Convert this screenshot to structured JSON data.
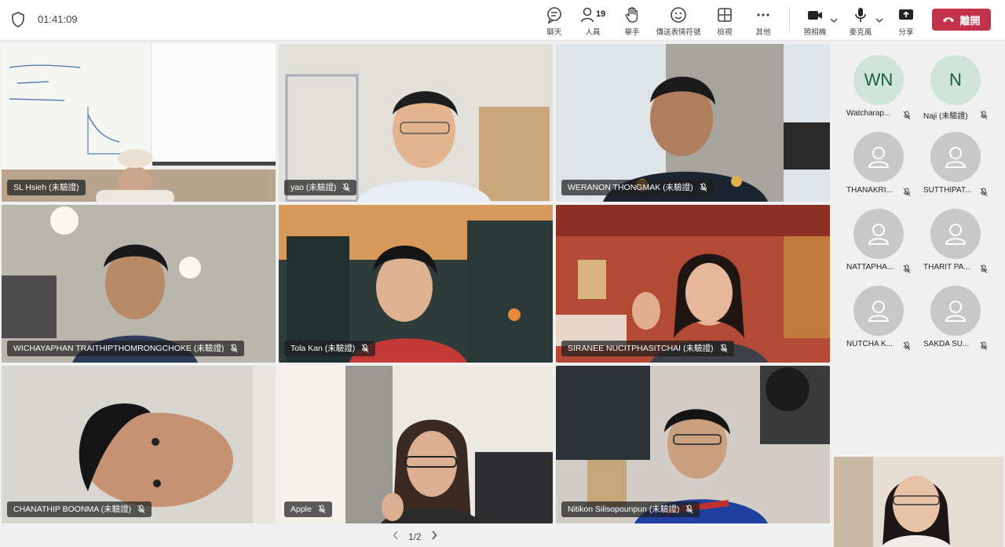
{
  "toolbar": {
    "timer": "01:41:09",
    "buttons": {
      "chat": "聊天",
      "people": "人員",
      "people_count": "19",
      "raise_hand": "舉手",
      "reactions": "傳送表情符號",
      "view": "檢視",
      "more": "其他",
      "camera": "照相機",
      "mic": "麥克風",
      "share": "分享"
    },
    "leave": "離開"
  },
  "tiles": [
    {
      "name": "SL Hsieh (未驗證)"
    },
    {
      "name": "yao (未驗證)"
    },
    {
      "name": "WERANON THONGMAK (未驗證)"
    },
    {
      "name": "WICHAYAPHAN TRAITHIPTHOMRONGCHOKE (未驗證)"
    },
    {
      "name": "Tola Kan (未驗證)"
    },
    {
      "name": "SIRANEE NUCITPHASITCHAI (未驗證)"
    },
    {
      "name": "CHANATHIP BOONMA (未驗證)"
    },
    {
      "name": "Apple"
    },
    {
      "name": "Nitikon Silisopounpun (未驗證)"
    }
  ],
  "roster": [
    {
      "initials": "WN",
      "name": "Watcharap..."
    },
    {
      "initials": "N",
      "name": "Naji (未驗證)"
    },
    {
      "initials": "",
      "name": "THANAKRI..."
    },
    {
      "initials": "",
      "name": "SUTTHIPAT..."
    },
    {
      "initials": "",
      "name": "NATTAPHA..."
    },
    {
      "initials": "",
      "name": "THARIT PA..."
    },
    {
      "initials": "",
      "name": "NUTCHA K..."
    },
    {
      "initials": "",
      "name": "SAKDA SU..."
    }
  ],
  "pager": {
    "label": "1/2"
  },
  "colors": {
    "leave": "#c4314b",
    "avatar_green": "#cfe5da",
    "avatar_gray": "#c8c8c8"
  }
}
